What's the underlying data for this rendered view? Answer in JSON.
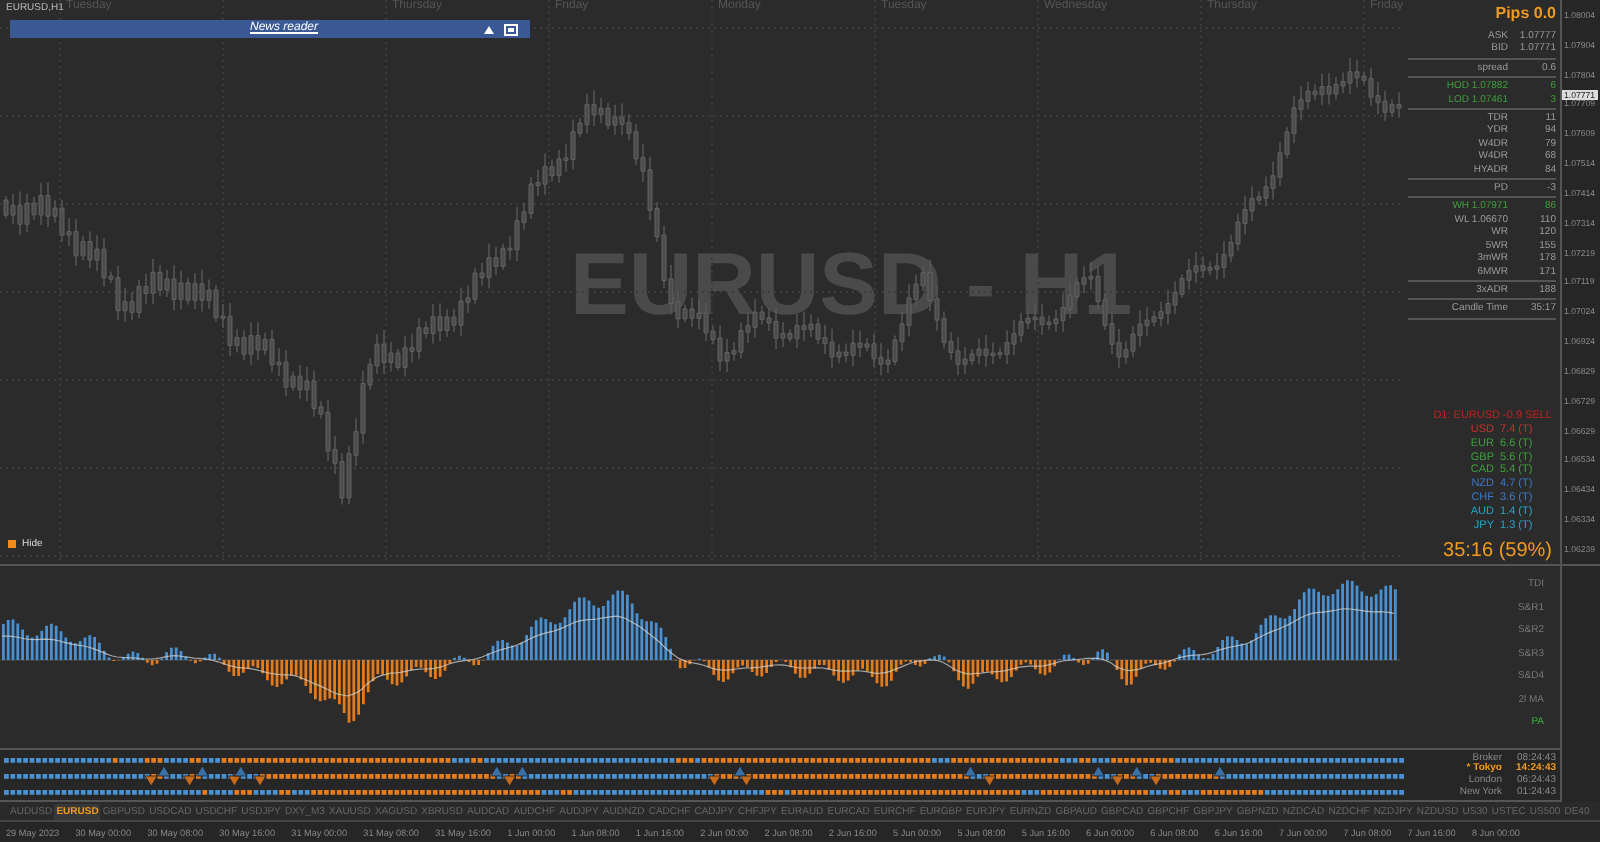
{
  "chart": {
    "symbol_label": "EURUSD,H1",
    "watermark": "EURUSD - H1",
    "news_reader": {
      "title": "News reader"
    },
    "days": [
      "Tuesday",
      "Thursday",
      "Friday",
      "Monday",
      "Tuesday",
      "Wednesday",
      "Thursday",
      "Friday"
    ],
    "hide_button": "Hide"
  },
  "price_axis": {
    "current_price": "1.07771",
    "labels": [
      "1.08004",
      "1.07904",
      "1.07804",
      "1.07709",
      "1.07609",
      "1.07514",
      "1.07414",
      "1.07314",
      "1.07219",
      "1.07119",
      "1.07024",
      "1.06924",
      "1.06829",
      "1.06729",
      "1.06629",
      "1.06534",
      "1.06434",
      "1.06334",
      "1.06239"
    ]
  },
  "info_panel": {
    "title": "Pips 0.0",
    "groups": [
      [
        {
          "label": "ASK",
          "value": "1.07777",
          "highlight": false
        },
        {
          "label": "BID",
          "value": "1.07771",
          "highlight": false
        }
      ],
      [
        {
          "label": "spread",
          "value": "0.6",
          "highlight": false
        }
      ],
      [
        {
          "label": "HOD 1.07882",
          "value": "6",
          "highlight": true
        },
        {
          "label": "LOD 1.07461",
          "value": "3",
          "highlight": true
        }
      ],
      [
        {
          "label": "TDR",
          "value": "11",
          "highlight": false
        },
        {
          "label": "YDR",
          "value": "94",
          "highlight": false
        },
        {
          "label": "W4DR",
          "value": "79",
          "highlight": false
        },
        {
          "label": "W4DR",
          "value": "68",
          "highlight": false
        },
        {
          "label": "HYADR",
          "value": "84",
          "highlight": false
        }
      ],
      [
        {
          "label": "PD",
          "value": "-3",
          "highlight": false
        }
      ],
      [
        {
          "label": "WH 1.07971",
          "value": "86",
          "highlight": true
        },
        {
          "label": "WL 1.06670",
          "value": "110",
          "highlight": false
        },
        {
          "label": "WR",
          "value": "120",
          "highlight": false
        },
        {
          "label": "5WR",
          "value": "155",
          "highlight": false
        },
        {
          "label": "3mWR",
          "value": "178",
          "highlight": false
        },
        {
          "label": "6MWR",
          "value": "171",
          "highlight": false
        }
      ],
      [
        {
          "label": "3xADR",
          "value": "188",
          "highlight": false
        }
      ],
      [
        {
          "label": "Candle Time",
          "value": "35:17",
          "highlight": false
        }
      ]
    ]
  },
  "strength": {
    "header": {
      "text": "D1: EURUSD -0.9 SELL",
      "color": "#c42020"
    },
    "items": [
      {
        "currency": "USD",
        "value": "7.4 (T)",
        "color": "#c83030"
      },
      {
        "currency": "EUR",
        "value": "6.6 (T)",
        "color": "#3ca03c"
      },
      {
        "currency": "GBP",
        "value": "5.6 (T)",
        "color": "#3ca03c"
      },
      {
        "currency": "CAD",
        "value": "5.4 (T)",
        "color": "#3ca03c"
      },
      {
        "currency": "NZD",
        "value": "4.7 (T)",
        "color": "#3c78c8"
      },
      {
        "currency": "CHF",
        "value": "3.6 (T)",
        "color": "#3c78c8"
      },
      {
        "currency": "AUD",
        "value": "1.4 (T)",
        "color": "#20a8c8"
      },
      {
        "currency": "JPY",
        "value": "1.3 (T)",
        "color": "#20a8c8"
      }
    ],
    "countdown": "35:16 (59%)"
  },
  "indicator": {
    "labels": [
      {
        "text": "TDI",
        "active": false
      },
      {
        "text": "S&R1",
        "active": false
      },
      {
        "text": "S&R2",
        "active": false
      },
      {
        "text": "S&R3",
        "active": false
      },
      {
        "text": "S&D4",
        "active": false
      },
      {
        "text": "2l MA",
        "active": false
      },
      {
        "text": "PA",
        "active": true
      }
    ]
  },
  "sessions": [
    {
      "name": "Broker",
      "time": "08:24:43",
      "current": false
    },
    {
      "name": "* Tokyo",
      "time": "14:24:43",
      "current": true
    },
    {
      "name": "London",
      "time": "06:24:43",
      "current": false
    },
    {
      "name": "New York",
      "time": "01:24:43",
      "current": false
    }
  ],
  "tabs": [
    {
      "label": "AUDUSD",
      "selected": false
    },
    {
      "label": "EURUSD",
      "selected": true
    },
    {
      "label": "GBPUSD",
      "selected": false
    },
    {
      "label": "USDCAD",
      "selected": false
    },
    {
      "label": "USDCHF",
      "selected": false
    },
    {
      "label": "USDJPY",
      "selected": false
    },
    {
      "label": "DXY_M3",
      "selected": false
    },
    {
      "label": "XAUUSD",
      "selected": false
    },
    {
      "label": "XAGUSD",
      "selected": false
    },
    {
      "label": "XBRUSD",
      "selected": false
    },
    {
      "label": "AUDCAD",
      "selected": false
    },
    {
      "label": "AUDCHF",
      "selected": false
    },
    {
      "label": "AUDJPY",
      "selected": false
    },
    {
      "label": "AUDNZD",
      "selected": false
    },
    {
      "label": "CADCHF",
      "selected": false
    },
    {
      "label": "CADJPY",
      "selected": false
    },
    {
      "label": "CHFJPY",
      "selected": false
    },
    {
      "label": "EURAUD",
      "selected": false
    },
    {
      "label": "EURCAD",
      "selected": false
    },
    {
      "label": "EURCHF",
      "selected": false
    },
    {
      "label": "EURGBP",
      "selected": false
    },
    {
      "label": "EURJPY",
      "selected": false
    },
    {
      "label": "EURNZD",
      "selected": false
    },
    {
      "label": "GBPAUD",
      "selected": false
    },
    {
      "label": "GBPCAD",
      "selected": false
    },
    {
      "label": "GBPCHF",
      "selected": false
    },
    {
      "label": "GBPJPY",
      "selected": false
    },
    {
      "label": "GBPNZD",
      "selected": false
    },
    {
      "label": "NZDCAD",
      "selected": false
    },
    {
      "label": "NZDCHF",
      "selected": false
    },
    {
      "label": "NZDJPY",
      "selected": false
    },
    {
      "label": "NZDUSD",
      "selected": false
    },
    {
      "label": "US30",
      "selected": false
    },
    {
      "label": "USTEC",
      "selected": false
    },
    {
      "label": "US500",
      "selected": false
    },
    {
      "label": "DE40",
      "selected": false
    }
  ],
  "time_axis": [
    "29 May 2023",
    "30 May 00:00",
    "30 May 08:00",
    "30 May 16:00",
    "31 May 00:00",
    "31 May 08:00",
    "31 May 16:00",
    "1 Jun 00:00",
    "1 Jun 08:00",
    "1 Jun 16:00",
    "2 Jun 00:00",
    "2 Jun 08:00",
    "2 Jun 16:00",
    "5 Jun 00:00",
    "5 Jun 08:00",
    "5 Jun 16:00",
    "6 Jun 00:00",
    "6 Jun 08:00",
    "6 Jun 16:00",
    "7 Jun 00:00",
    "7 Jun 08:00",
    "7 Jun 16:00",
    "8 Jun 00:00"
  ]
}
